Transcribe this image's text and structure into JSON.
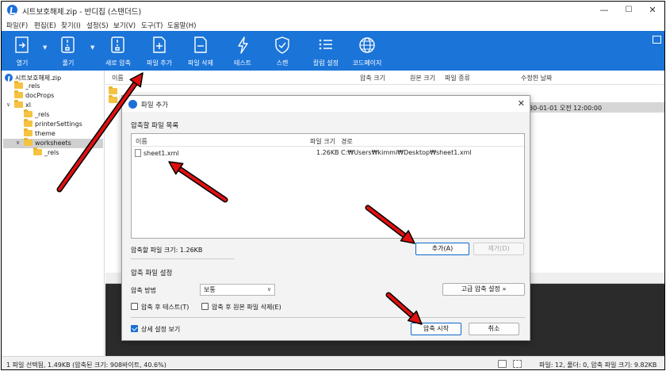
{
  "window": {
    "title": "시트보호해제.zip - 반디집 (스탠더드)",
    "minimize": "—",
    "maximize": "☐",
    "close": "✕"
  },
  "menu": [
    "파일(F)",
    "편집(E)",
    "찾기(I)",
    "설정(S)",
    "보기(V)",
    "도구(T)",
    "도움말(H)"
  ],
  "ribbon": {
    "color": "#1b74d8",
    "buttons": [
      {
        "label": "열기",
        "icon": "open-archive-icon"
      },
      {
        "label": "풀기",
        "icon": "extract-icon"
      },
      {
        "label": "새로 압축",
        "icon": "new-archive-icon"
      },
      {
        "label": "파일 추가",
        "icon": "add-file-icon"
      },
      {
        "label": "파일 삭제",
        "icon": "delete-file-icon"
      },
      {
        "label": "테스트",
        "icon": "test-icon"
      },
      {
        "label": "스캔",
        "icon": "scan-shield-icon"
      },
      {
        "label": "칼럼 설정",
        "icon": "column-settings-icon"
      },
      {
        "label": "코드페이지",
        "icon": "codepage-globe-icon"
      }
    ]
  },
  "tree": {
    "items": [
      "시트보호해제.zip",
      "_rels",
      "docProps",
      "xl",
      "_rels",
      "printerSettings",
      "theme",
      "worksheets",
      "_rels"
    ]
  },
  "filelist": {
    "columns": [
      "이름",
      "압축 크기",
      "원본 크기",
      "파일 종류",
      "수정한 날짜"
    ],
    "visible_date": "80-01-01 오전 12:00:00"
  },
  "dialog": {
    "title": "파일 추가",
    "list_section": "압축할 파일 목록",
    "columns": {
      "name": "이름",
      "size": "파일 크기",
      "path": "경로"
    },
    "files": [
      {
        "name": "sheet1.xml",
        "size": "1.26KB",
        "path": "C:₩Users₩kimmi₩Desktop₩sheet1.xml"
      }
    ],
    "total_size": "압축할 파일 크기: 1.26KB",
    "add_button": "추가(A)",
    "remove_button": "제거(D)",
    "settings_section": "압축 파일 설정",
    "method_label": "압축 방법",
    "method_value": "보통",
    "advanced_button": "고급 압축 설정 »",
    "test_after": "압축 후 테스트(T)",
    "delete_after": "압축 후 원본 파일 삭제(E)",
    "show_details": "상세 설정 보기",
    "start_button": "압축 시작",
    "cancel_button": "취소"
  },
  "status": {
    "left": "1 파일 선택됨, 1.49KB (압축된 크기: 908바이트, 40.6%)",
    "right": "파일: 12, 폴더: 0, 압축 파일 크기: 9.82KB"
  },
  "annotation_color": "#e01010"
}
